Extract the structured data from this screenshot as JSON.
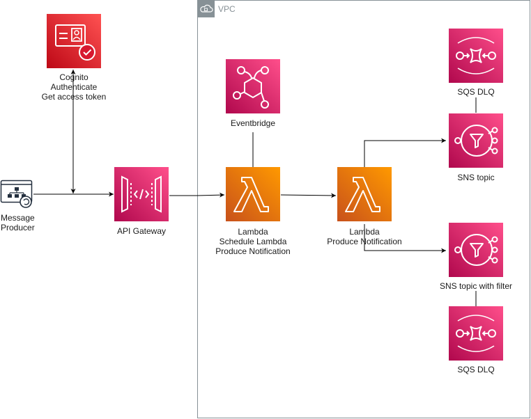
{
  "vpc": {
    "label": "VPC"
  },
  "nodes": {
    "cognito": {
      "lines": [
        "Cognito",
        "Authenticate",
        "Get access token"
      ],
      "icon": "cognito-icon"
    },
    "producer": {
      "lines": [
        "Message",
        "Producer"
      ],
      "icon": "message-producer-icon"
    },
    "api_gateway": {
      "label": "API Gateway",
      "icon": "api-gateway-icon"
    },
    "eventbridge": {
      "label": "Eventbridge",
      "icon": "eventbridge-icon"
    },
    "lambda_schedule": {
      "lines": [
        "Lambda",
        "Schedule Lambda",
        "Produce Notification"
      ],
      "icon": "lambda-icon"
    },
    "lambda_produce": {
      "lines": [
        "Lambda",
        "Produce Notification"
      ],
      "icon": "lambda-icon"
    },
    "sqs_dlq_top": {
      "label": "SQS DLQ",
      "icon": "sqs-icon"
    },
    "sns_topic": {
      "label": "SNS topic",
      "icon": "sns-icon"
    },
    "sns_filter": {
      "label": "SNS topic with filter",
      "icon": "sns-icon"
    },
    "sqs_dlq_bottom": {
      "label": "SQS DLQ",
      "icon": "sqs-icon"
    }
  },
  "colors": {
    "pink": "#E7157B",
    "pink_dark": "#BC1356",
    "orange": "#F78E04",
    "orange_dark": "#D05C17",
    "red": "#DD344C",
    "red_dark": "#BD0816",
    "vpc_border": "#879196",
    "line": "#000000"
  }
}
